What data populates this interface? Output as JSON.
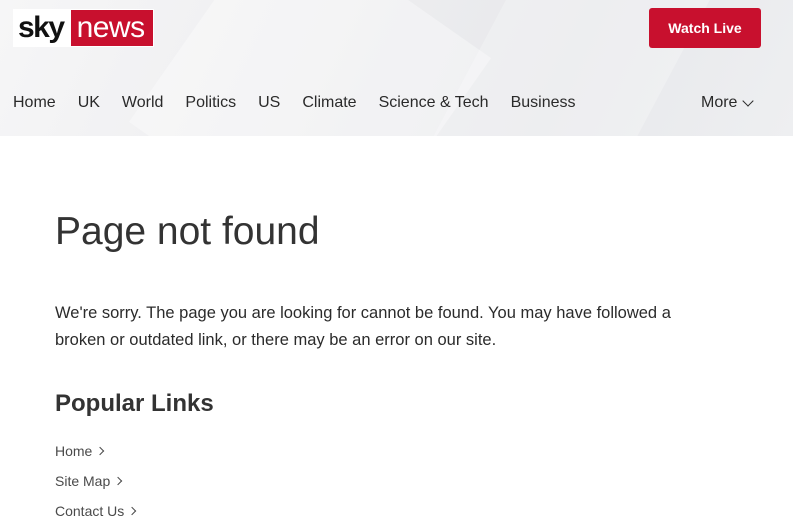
{
  "header": {
    "logo": {
      "part1": "sky",
      "part2": "news"
    },
    "watch_live_label": "Watch Live",
    "nav": [
      {
        "label": "Home"
      },
      {
        "label": "UK"
      },
      {
        "label": "World"
      },
      {
        "label": "Politics"
      },
      {
        "label": "US"
      },
      {
        "label": "Climate"
      },
      {
        "label": "Science & Tech"
      },
      {
        "label": "Business"
      }
    ],
    "more_label": "More"
  },
  "main": {
    "title": "Page not found",
    "message": "We're sorry. The page you are looking for cannot be found. You may have followed a broken or outdated link, or there may be an error on our site.",
    "popular_title": "Popular Links",
    "popular_links": [
      {
        "label": "Home"
      },
      {
        "label": "Site Map"
      },
      {
        "label": "Contact Us"
      }
    ]
  },
  "colors": {
    "brand_red": "#c8102e",
    "text": "#333333"
  },
  "icons": {
    "more": "chevron-down-icon",
    "link": "chevron-right-icon"
  }
}
